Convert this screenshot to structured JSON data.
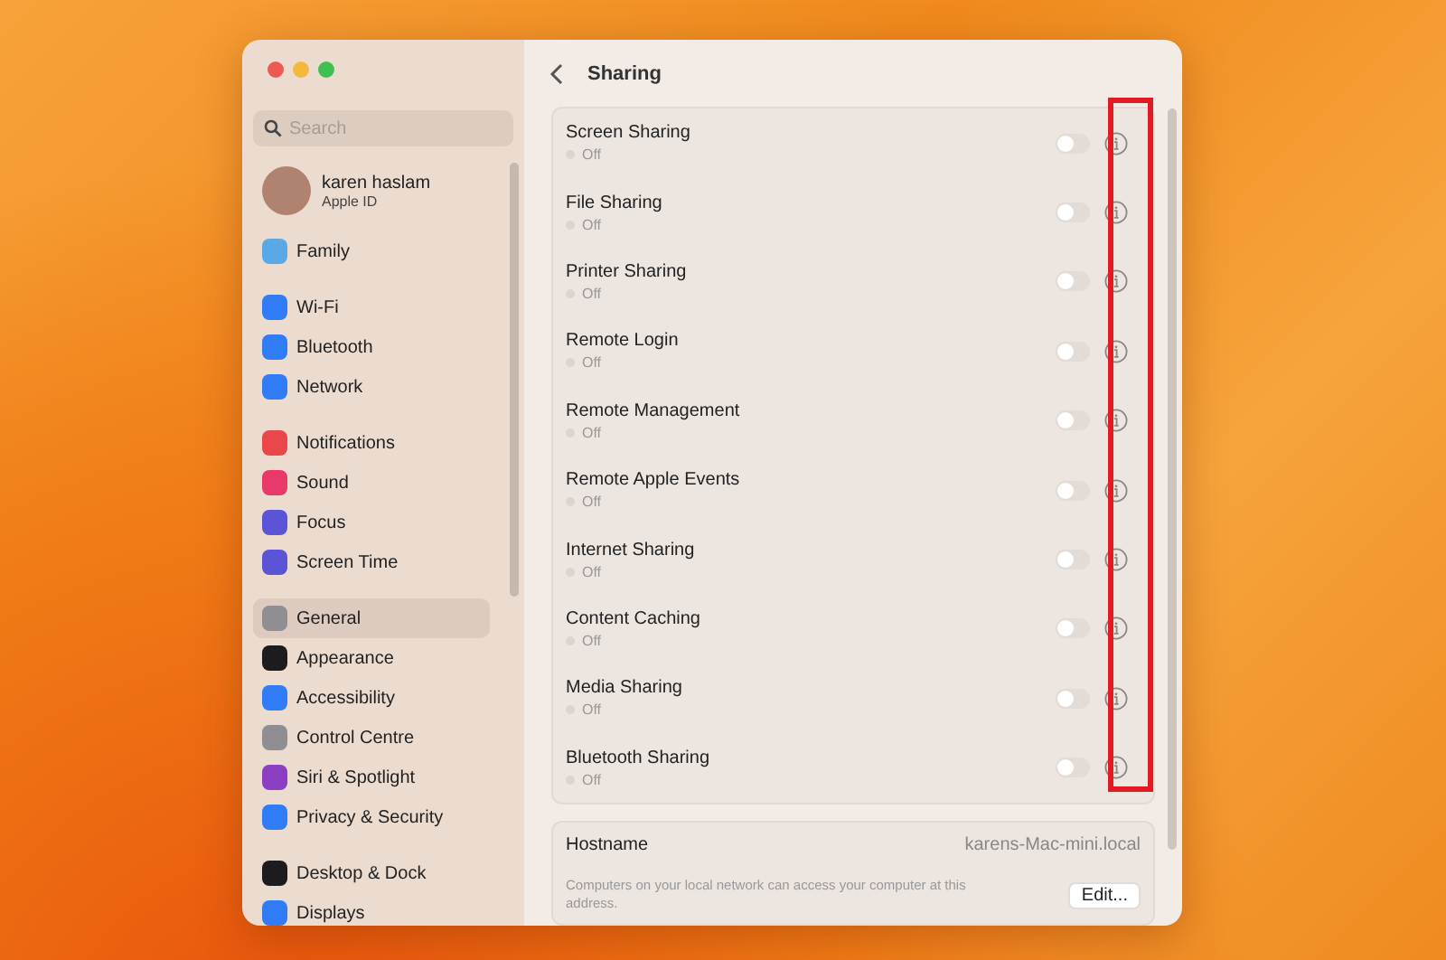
{
  "sidebar": {
    "search": {
      "placeholder": "Search"
    },
    "profile": {
      "name": "karen haslam",
      "subtitle": "Apple ID"
    },
    "groups": [
      [
        {
          "label": "Family",
          "color": "#5aa9e6",
          "selected": false
        }
      ],
      [
        {
          "label": "Wi-Fi",
          "color": "#2f7cf6",
          "selected": false
        },
        {
          "label": "Bluetooth",
          "color": "#2f7cf6",
          "selected": false
        },
        {
          "label": "Network",
          "color": "#2f7cf6",
          "selected": false
        }
      ],
      [
        {
          "label": "Notifications",
          "color": "#e9474a",
          "selected": false
        },
        {
          "label": "Sound",
          "color": "#e8396a",
          "selected": false
        },
        {
          "label": "Focus",
          "color": "#5b54d6",
          "selected": false
        },
        {
          "label": "Screen Time",
          "color": "#5b54d6",
          "selected": false
        }
      ],
      [
        {
          "label": "General",
          "color": "#8e8e93",
          "selected": true
        },
        {
          "label": "Appearance",
          "color": "#1c1c1e",
          "selected": false
        },
        {
          "label": "Accessibility",
          "color": "#2f7cf6",
          "selected": false
        },
        {
          "label": "Control Centre",
          "color": "#8e8e93",
          "selected": false
        },
        {
          "label": "Siri & Spotlight",
          "color": "#8a3ec2",
          "selected": false
        },
        {
          "label": "Privacy & Security",
          "color": "#2f7cf6",
          "selected": false
        }
      ],
      [
        {
          "label": "Desktop & Dock",
          "color": "#1c1c1e",
          "selected": false
        },
        {
          "label": "Displays",
          "color": "#2f7cf6",
          "selected": false
        }
      ]
    ]
  },
  "content": {
    "title": "Sharing",
    "services": [
      {
        "name": "Screen Sharing",
        "status": "Off",
        "on": false
      },
      {
        "name": "File Sharing",
        "status": "Off",
        "on": false
      },
      {
        "name": "Printer Sharing",
        "status": "Off",
        "on": false
      },
      {
        "name": "Remote Login",
        "status": "Off",
        "on": false
      },
      {
        "name": "Remote Management",
        "status": "Off",
        "on": false
      },
      {
        "name": "Remote Apple Events",
        "status": "Off",
        "on": false
      },
      {
        "name": "Internet Sharing",
        "status": "Off",
        "on": false
      },
      {
        "name": "Content Caching",
        "status": "Off",
        "on": false
      },
      {
        "name": "Media Sharing",
        "status": "Off",
        "on": false
      },
      {
        "name": "Bluetooth Sharing",
        "status": "Off",
        "on": false
      }
    ],
    "hostname": {
      "label": "Hostname",
      "value": "karens-Mac-mini.local",
      "description": "Computers on your local network can access your computer at this address.",
      "button": "Edit..."
    }
  }
}
